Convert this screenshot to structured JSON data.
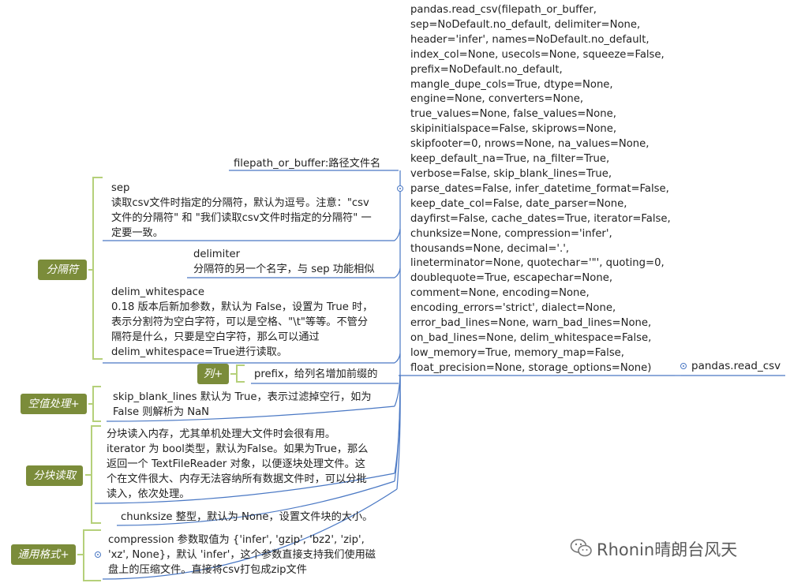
{
  "signature_lines": [
    "pandas.read_csv(filepath_or_buffer,",
    "sep=NoDefault.no_default, delimiter=None,",
    "header='infer', names=NoDefault.no_default,",
    "index_col=None, usecols=None, squeeze=False,",
    "prefix=NoDefault.no_default,",
    "mangle_dupe_cols=True, dtype=None,",
    "engine=None, converters=None,",
    "true_values=None, false_values=None,",
    "skipinitialspace=False, skiprows=None,",
    "skipfooter=0, nrows=None, na_values=None,",
    "keep_default_na=True, na_filter=True,",
    "verbose=False, skip_blank_lines=True,",
    "parse_dates=False, infer_datetime_format=False,",
    "keep_date_col=False, date_parser=None,",
    "dayfirst=False, cache_dates=True, iterator=False,",
    "chunksize=None, compression='infer',",
    "thousands=None, decimal='.',",
    "lineterminator=None, quotechar='\"', quoting=0,",
    "doublequote=True, escapechar=None,",
    "comment=None, encoding=None,",
    "encoding_errors='strict', dialect=None,",
    "error_bad_lines=None, warn_bad_lines=None,",
    "on_bad_lines=None, delim_whitespace=False,",
    "low_memory=True, memory_map=False,",
    "float_precision=None, storage_options=None)"
  ],
  "root": {
    "label": "pandas.read_csv"
  },
  "filepath": {
    "text": "filepath_or_buffer:路径文件名"
  },
  "categories": {
    "separator": "分隔符",
    "columns": "列+",
    "null_handling": "空值处理+",
    "chunk_reading": "分块读取",
    "general_format": "通用格式+"
  },
  "sep": {
    "lines": [
      "sep",
      "读取csv文件时指定的分隔符，默认为逗号。注意：\"csv",
      "文件的分隔符\" 和 \"我们读取csv文件时指定的分隔符\" 一",
      "定要一致。"
    ]
  },
  "delimiter": {
    "lines": [
      "delimiter",
      "分隔符的另一个名字，与 sep 功能相似"
    ]
  },
  "delim_whitespace": {
    "lines": [
      "delim_whitespace",
      "0.18 版本后新加参数，默认为 False，设置为 True 时，",
      "表示分割符为空白字符，可以是空格、\"\\t\"等等。不管分",
      "隔符是什么，只要是空白字符，那么可以通过",
      "delim_whitespace=True进行读取。"
    ]
  },
  "prefix": {
    "text": "prefix，给列名增加前缀的"
  },
  "skip_blank_lines": {
    "lines": [
      "skip_blank_lines 默认为 True，表示过滤掉空行，如为",
      "False 则解析为 NaN"
    ]
  },
  "iterator": {
    "lines": [
      "分块读入内存，尤其单机处理大文件时会很有用。",
      "iterator 为 bool类型，默认为False。如果为True，那么",
      "返回一个 TextFileReader 对象，以便逐块处理文件。这",
      "个在文件很大、内存无法容纳所有数据文件时，可以分批",
      "读入，依次处理。"
    ]
  },
  "chunksize": {
    "text": "chunksize 整型，默认为 None，设置文件块的大小。"
  },
  "compression": {
    "lines": [
      "compression 参数取值为 {'infer', 'gzip', 'bz2', 'zip',",
      "'xz', None}，默认 'infer'，这个参数直接支持我们使用磁",
      "盘上的压缩文件。直接将csv打包成zip文件"
    ]
  },
  "watermark": {
    "text": "Rhonin晴朗台风天"
  },
  "colors": {
    "branch_line": "#4a78c4",
    "category_fill": "#7b8c3a",
    "bracket": "#b5d07a"
  }
}
